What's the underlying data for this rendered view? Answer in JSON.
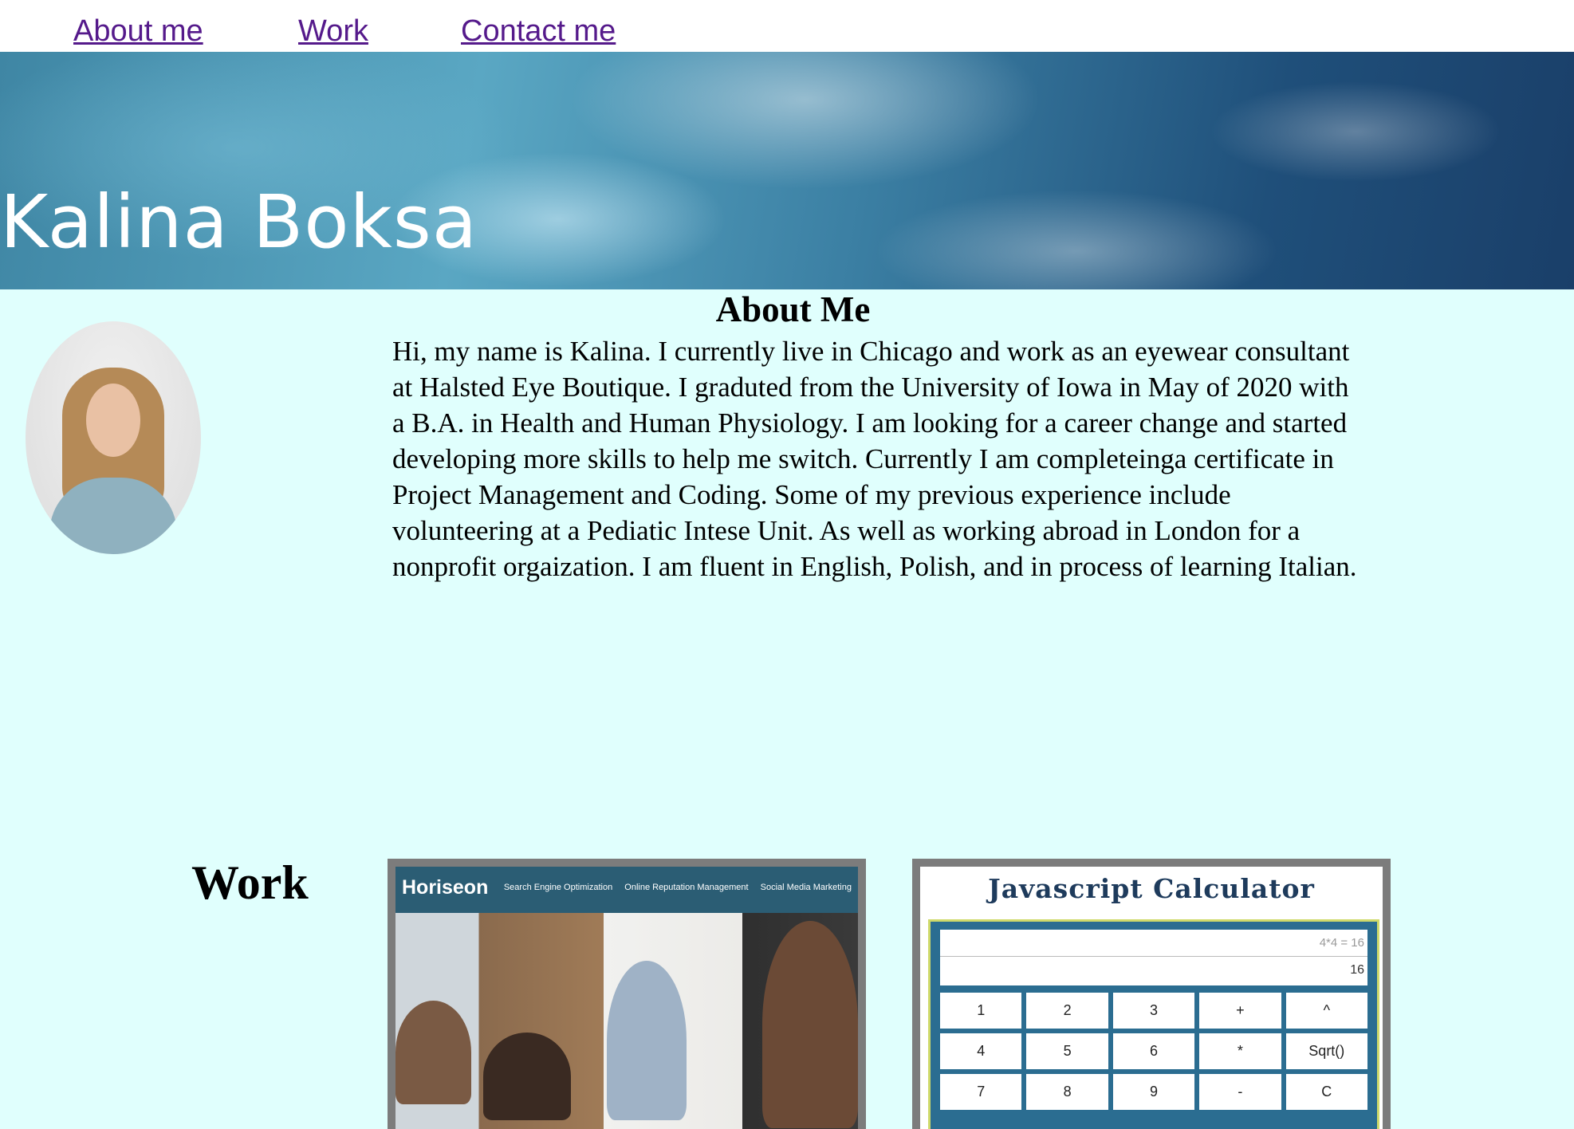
{
  "nav": {
    "about": "About me",
    "work": "Work",
    "contact": "Contact me"
  },
  "banner": {
    "title": "Kalina Boksa"
  },
  "about": {
    "heading": "About Me",
    "text": "Hi, my name is Kalina. I currently live in Chicago and work as an eyewear consultant at Halsted Eye Boutique. I graduted from the University of Iowa in May of 2020 with a B.A. in Health and Human Physiology. I am looking for a career change and started developing more skills to help me switch. Currently I am completeinga certificate in Project Management and Coding. Some of my previous experience include volunteering at a Pediatic Intese Unit. As well as working abroad in London for a nonprofit orgaization. I am fluent in English, Polish, and in process of learning Italian."
  },
  "work": {
    "heading": "Work",
    "horiseon": {
      "logo": "Horiseon",
      "links": [
        "Search Engine Optimization",
        "Online Reputation Management",
        "Social Media Marketing"
      ]
    },
    "calculator": {
      "title": "Javascript Calculator",
      "expression": "4*4 = 16",
      "result": "16",
      "keys": [
        "1",
        "2",
        "3",
        "+",
        "^",
        "4",
        "5",
        "6",
        "*",
        "Sqrt()",
        "7",
        "8",
        "9",
        "-",
        "C"
      ]
    }
  }
}
